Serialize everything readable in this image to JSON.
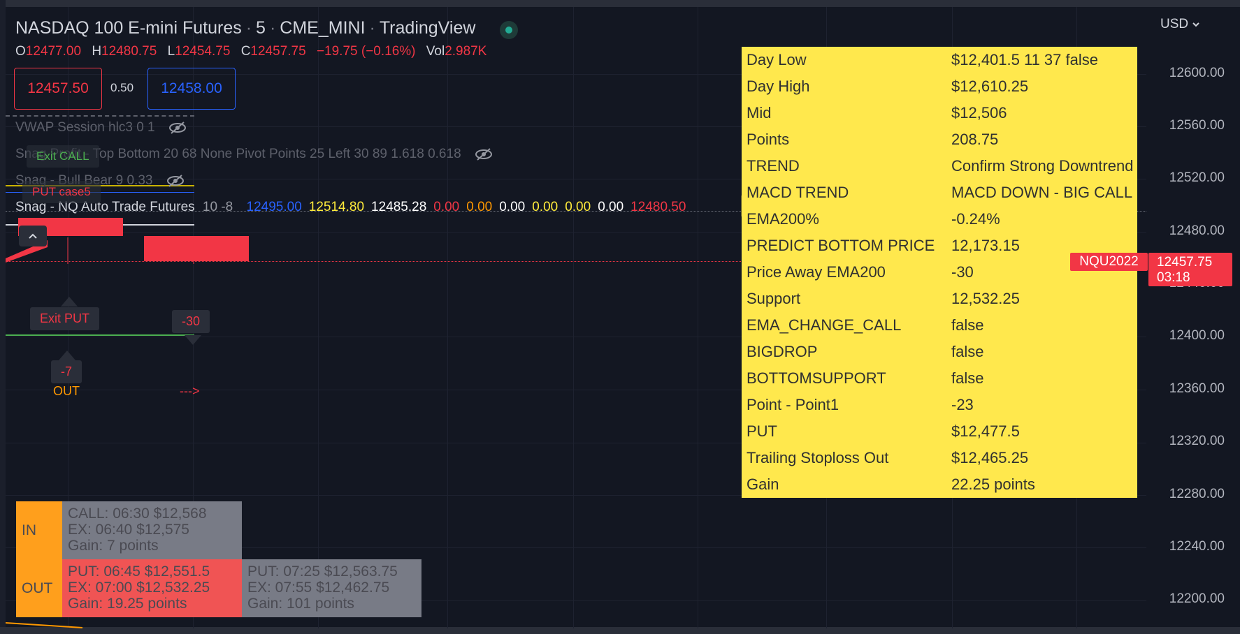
{
  "header": {
    "symbol": "NASDAQ 100 E-mini Futures",
    "interval": "5",
    "exchange": "CME_MINI",
    "source": "TradingView",
    "ohlc": {
      "o_label": "O",
      "o": "12477.00",
      "h_label": "H",
      "h": "12480.75",
      "l_label": "L",
      "l": "12454.75",
      "c_label": "C",
      "c": "12457.75",
      "change": "−19.75 (−0.16%)",
      "vol_label": "Vol",
      "vol": "2.987K"
    },
    "sell_price": "12457.50",
    "spread": "0.50",
    "buy_price": "12458.00"
  },
  "indicators": {
    "vwap": "VWAP Session hlc3 0 1",
    "snag_profit": "Snag Profit - Top Bottom 20 68 None Pivot Points 25 Left 30 89 1.618 0.618",
    "snag_bull_bear": "Snag - Bull Bear 9 0.33",
    "nq_auto_name": "Snag - NQ Auto Trade Futures",
    "nq_auto_params": "10 -8",
    "nq_auto_values": [
      "12495.00",
      "12514.80",
      "12485.28",
      "0.00",
      "0.00",
      "0.00",
      "0.00",
      "0.00",
      "0.00",
      "12480.50"
    ],
    "nq_auto_colors": [
      "#2962ff",
      "#ffeb3b",
      "#ffffff",
      "#f23645",
      "#ff9800",
      "#ffffff",
      "#ffeb3b",
      "#ffeb3b",
      "#ffffff",
      "#f23645"
    ]
  },
  "chart_labels": {
    "exit_call": "Exit CALL",
    "put_case": "PUT case5",
    "exit_put": "Exit PUT",
    "minus30": "-30",
    "minus7": "-7",
    "out": "OUT",
    "arrow": "--->"
  },
  "info_panel": [
    {
      "k": "Day Low",
      "v": "$12,401.5 11 37 false"
    },
    {
      "k": "Day High",
      "v": "$12,610.25"
    },
    {
      "k": "Mid",
      "v": "$12,506"
    },
    {
      "k": "Points",
      "v": "208.75"
    },
    {
      "k": "TREND",
      "v": "Confirm Strong Downtrend"
    },
    {
      "k": "MACD TREND",
      "v": "MACD DOWN - BIG CALL"
    },
    {
      "k": "EMA200%",
      "v": "-0.24%"
    },
    {
      "k": "PREDICT BOTTOM PRICE",
      "v": "12,173.15"
    },
    {
      "k": "Price Away EMA200",
      "v": "-30"
    },
    {
      "k": "Support",
      "v": "12,532.25"
    },
    {
      "k": "EMA_CHANGE_CALL",
      "v": "false"
    },
    {
      "k": "BIGDROP",
      "v": "false"
    },
    {
      "k": "BOTTOMSUPPORT",
      "v": "false"
    },
    {
      "k": "Point - Point1",
      "v": "-23"
    },
    {
      "k": "PUT",
      "v": "$12,477.5"
    },
    {
      "k": "Trailing Stoploss Out",
      "v": "$12,465.25"
    },
    {
      "k": "Gain",
      "v": "22.25 points"
    }
  ],
  "price_axis": {
    "currency": "USD",
    "ticks": [
      "12600.00",
      "12560.00",
      "12520.00",
      "12480.00",
      "12440.00",
      "12400.00",
      "12360.00",
      "12320.00",
      "12280.00",
      "12240.00",
      "12200.00"
    ],
    "symbol_tag": "NQU2022",
    "last_price": "12457.75",
    "countdown": "03:18"
  },
  "trades_table": {
    "in_label": "IN",
    "out_label": "OUT",
    "in_cell": [
      "CALL: 06:30 $12,568",
      "EX: 06:40 $12,575",
      "Gain: 7 points"
    ],
    "out_cell_1": [
      "PUT: 06:45 $12,551.5",
      "EX: 07:00 $12,532.25",
      "Gain: 19.25 points"
    ],
    "out_cell_2": [
      "PUT: 07:25 $12,563.75",
      "EX: 07:55 $12,462.75",
      "Gain: 101 points"
    ]
  },
  "colors": {
    "background": "#131722",
    "down": "#f23645",
    "up_line": "#2962ff",
    "info_panel": "#ffe84d",
    "orange": "#ff9f1c"
  }
}
